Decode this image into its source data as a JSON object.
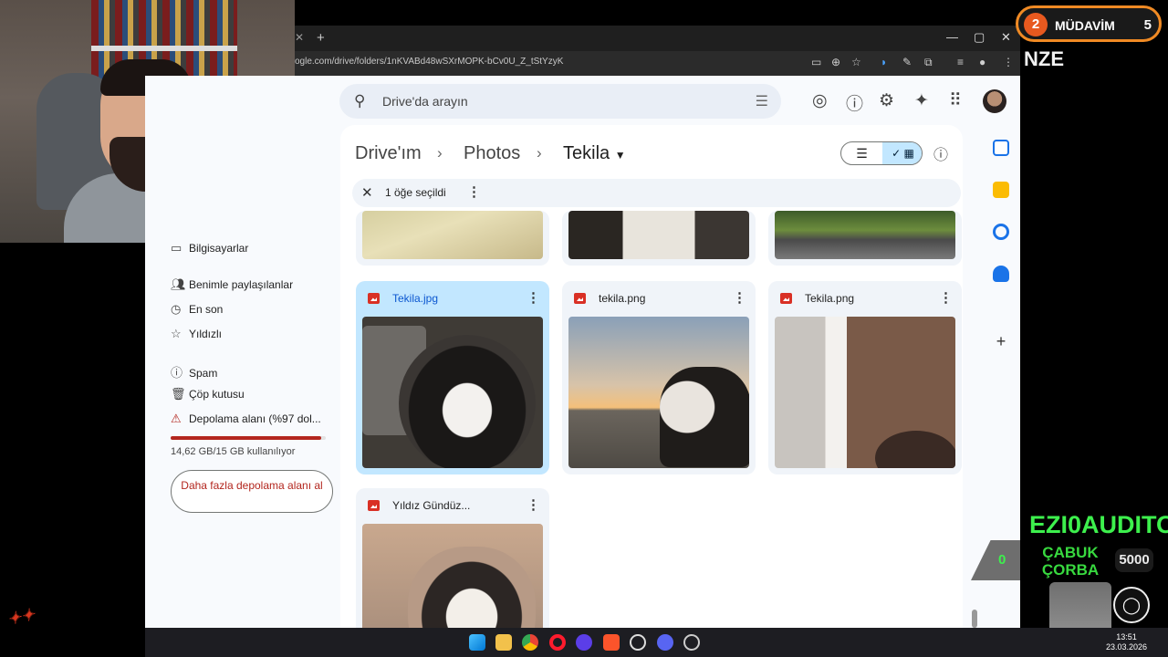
{
  "browser": {
    "new_tab": "+",
    "url": "ogle.com/drive/folders/1nKVABd48wSXrMOPK-bCv0U_Z_tStYzyK",
    "window_controls": {
      "minimize": "—",
      "maximize": "▢",
      "close": "✕"
    }
  },
  "drive": {
    "search_placeholder": "Drive'da arayın",
    "breadcrumb": [
      "Drive'ım",
      "Photos",
      "Tekila"
    ],
    "selection_text": "1 öğe seçildi",
    "nav": [
      {
        "icon": "computer-icon",
        "label": "Bilgisayarlar"
      },
      {
        "icon": "shared-icon",
        "label": "Benimle paylaşılanlar"
      },
      {
        "icon": "clock-icon",
        "label": "En son"
      },
      {
        "icon": "star-icon",
        "label": "Yıldızlı"
      },
      {
        "icon": "spam-icon",
        "label": "Spam"
      },
      {
        "icon": "trash-icon",
        "label": "Çöp kutusu"
      },
      {
        "icon": "warning-icon",
        "label": "Depolama alanı (%97 dol..."
      }
    ],
    "storage_used_fraction": 0.97,
    "storage_text": "14,62 GB/15 GB kullanılıyor",
    "get_more_storage": "Daha fazla depolama alanı al",
    "files": [
      {
        "name": "Tekila.jpg",
        "selected": true
      },
      {
        "name": "tekila.png",
        "selected": false
      },
      {
        "name": "Tekila.png",
        "selected": false
      },
      {
        "name": "Yıldız Gündüz...",
        "selected": false
      }
    ],
    "colors": {
      "selected": "#c2e7ff",
      "accent": "#0b57d0",
      "warning": "#b3261e"
    }
  },
  "overlay": {
    "viewer_left": "2",
    "viewer_label": "MÜDAVİM",
    "viewer_right": "5",
    "nze": "NZE",
    "ezio": "EZI0AUDITO",
    "cabuk": "ÇABUK ÇORBA",
    "score": "5000",
    "zero": "0"
  },
  "taskbar": {
    "time": "13:51",
    "date": "23.03.2026"
  }
}
